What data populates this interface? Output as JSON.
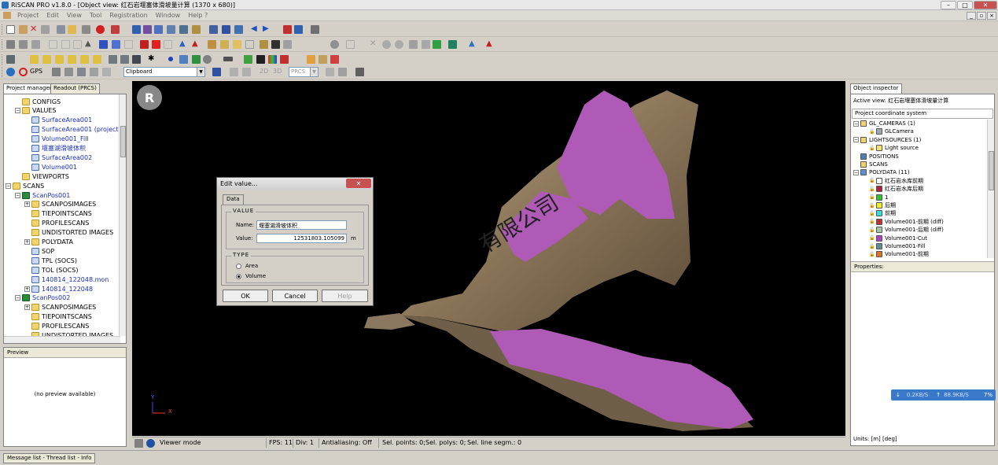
{
  "window": {
    "title": "RiSCAN PRO v1.8.0 - [Object view: 红石岩堰塞体滑坡量计算 (1370 x 680)]",
    "min": "–",
    "max": "□",
    "close": "✕"
  },
  "menu": [
    "Project",
    "Edit",
    "View",
    "Tool",
    "Registration",
    "Window",
    "Help ?"
  ],
  "toolbar": {
    "gps_label": "GPS",
    "clipboard_value": "Clipboard",
    "btn_2d": "2D",
    "btn_3d": "3D",
    "coord_value": "PRCS"
  },
  "left_panel": {
    "tabs": [
      "Project manager",
      "Readout (PRCS)"
    ],
    "tree": [
      {
        "label": "CONFIGS",
        "indent": 1,
        "type": "folder",
        "expander": ""
      },
      {
        "label": "VALUES",
        "indent": 1,
        "type": "folder",
        "expander": "−"
      },
      {
        "label": "SurfaceArea001",
        "indent": 2,
        "type": "doc",
        "blue": true
      },
      {
        "label": "SurfaceArea001 (projected)",
        "indent": 2,
        "type": "doc",
        "blue": true
      },
      {
        "label": "Volume001_Fill",
        "indent": 2,
        "type": "doc",
        "blue": true
      },
      {
        "label": "堰塞湖滑坡体积",
        "indent": 2,
        "type": "doc",
        "blue": true
      },
      {
        "label": "SurfaceArea002",
        "indent": 2,
        "type": "doc",
        "blue": true
      },
      {
        "label": "Volume001",
        "indent": 2,
        "type": "doc",
        "blue": true
      },
      {
        "label": "VIEWPORTS",
        "indent": 1,
        "type": "folder",
        "expander": ""
      },
      {
        "label": "SCANS",
        "indent": 0,
        "type": "folder",
        "expander": "−"
      },
      {
        "label": "ScanPos001",
        "indent": 1,
        "type": "scan",
        "expander": "−",
        "blue": true
      },
      {
        "label": "SCANPOSIMAGES",
        "indent": 2,
        "type": "folder",
        "expander": "+"
      },
      {
        "label": "TIEPOINTSCANS",
        "indent": 2,
        "type": "folder",
        "expander": ""
      },
      {
        "label": "PROFILESCANS",
        "indent": 2,
        "type": "folder",
        "expander": ""
      },
      {
        "label": "UNDISTORTED IMAGES",
        "indent": 2,
        "type": "folder",
        "expander": ""
      },
      {
        "label": "POLYDATA",
        "indent": 2,
        "type": "folder",
        "expander": "+"
      },
      {
        "label": "SOP",
        "indent": 2,
        "type": "doc",
        "expander": ""
      },
      {
        "label": "TPL (SOCS)",
        "indent": 2,
        "type": "doc",
        "expander": ""
      },
      {
        "label": "TOL (SOCS)",
        "indent": 2,
        "type": "doc",
        "expander": ""
      },
      {
        "label": "140814_122048.mon",
        "indent": 2,
        "type": "doc",
        "blue": true
      },
      {
        "label": "140814_122048",
        "indent": 2,
        "type": "doc",
        "blue": true,
        "expander": "+"
      },
      {
        "label": "ScanPos002",
        "indent": 1,
        "type": "scan",
        "expander": "−",
        "blue": true
      },
      {
        "label": "SCANPOSIMAGES",
        "indent": 2,
        "type": "folder",
        "expander": "+"
      },
      {
        "label": "TIEPOINTSCANS",
        "indent": 2,
        "type": "folder",
        "expander": ""
      },
      {
        "label": "PROFILESCANS",
        "indent": 2,
        "type": "folder",
        "expander": ""
      },
      {
        "label": "UNDISTORTED IMAGES",
        "indent": 2,
        "type": "folder",
        "expander": ""
      }
    ],
    "preview_title": "Preview",
    "preview_text": "(no preview available)"
  },
  "viewport": {
    "watermark": "有限公司",
    "axis_y": "Y",
    "axis_x": "X"
  },
  "dialog": {
    "title": "Edit value...",
    "close": "✕",
    "tab": "Data",
    "value_group": "VALUE",
    "name_label": "Name:",
    "name_value": "堰塞湖滑坡体积",
    "value_label": "Value:",
    "value_value": "12531803.105099",
    "unit": "m",
    "type_group": "TYPE",
    "type_options": [
      "Area",
      "Volume"
    ],
    "type_selected": "Volume",
    "ok": "OK",
    "cancel": "Cancel",
    "help": "Help"
  },
  "status": {
    "mode": "Viewer mode",
    "fps": "FPS: 11",
    "div": "Div: 1",
    "antialiasing": "Antialiasing: Off",
    "sel_points": "Sel. points: 0;",
    "sel_polys": "Sel. polys: 0;",
    "sel_lines": "Sel. line segm.: 0"
  },
  "right_panel": {
    "tab": "Object inspector",
    "active_view_label": "Active view:",
    "active_view_value": "红石岩堰塞体滑坡量计算",
    "coord_system": "Project coordinate system",
    "tree": [
      {
        "label": "GL_CAMERAS (1)",
        "indent": 0,
        "expander": "−",
        "color": "#f3d36b"
      },
      {
        "label": "GLCamera",
        "indent": 1,
        "expander": "",
        "color": "#9aa8b8"
      },
      {
        "label": "LIGHTSOURCES (1)",
        "indent": 0,
        "expander": "−",
        "color": "#f3d36b"
      },
      {
        "label": "Light source",
        "indent": 1,
        "expander": "",
        "color": "#f5e26b"
      },
      {
        "label": "POSITIONS",
        "indent": 0,
        "expander": "",
        "color": "#4a7fb8"
      },
      {
        "label": "SCANS",
        "indent": 0,
        "expander": "",
        "color": "#f3d36b"
      },
      {
        "label": "POLYDATA (11)",
        "indent": 0,
        "expander": "−",
        "color": "#5a8fd0"
      },
      {
        "label": "红石岩水库前期",
        "indent": 1,
        "expander": "",
        "color": "#ffffff"
      },
      {
        "label": "红石岩水库后期",
        "indent": 1,
        "expander": "",
        "color": "#b0203a"
      },
      {
        "label": "1",
        "indent": 1,
        "expander": "",
        "color": "#30c030"
      },
      {
        "label": "后期",
        "indent": 1,
        "expander": "",
        "color": "#f0f020"
      },
      {
        "label": "前期",
        "indent": 1,
        "expander": "",
        "color": "#30e0e0"
      },
      {
        "label": "Volume001-前期 (diff)",
        "indent": 1,
        "expander": "",
        "color": "#c03030"
      },
      {
        "label": "Volume001-后期 (diff)",
        "indent": 1,
        "expander": "",
        "color": "#a0c8a0"
      },
      {
        "label": "Volume001-Cut",
        "indent": 1,
        "expander": "",
        "color": "#b040c0"
      },
      {
        "label": "Volume001-Fill",
        "indent": 1,
        "expander": "",
        "color": "#5a9090"
      },
      {
        "label": "Volume001-前期",
        "indent": 1,
        "expander": "",
        "color": "#e07020"
      }
    ],
    "properties_title": "Properties:",
    "units": "Units: [m] [deg]"
  },
  "network": {
    "down": "0.2KB/S",
    "up": "88.9KB/S",
    "pct": "7%"
  },
  "bottom": {
    "tabs": "Message list - Thread list - Info"
  }
}
